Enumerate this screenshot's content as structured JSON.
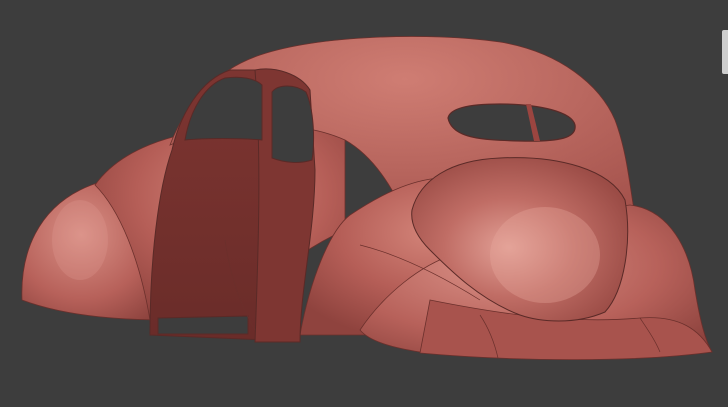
{
  "viewport": {
    "background": "#3d3d3d",
    "subject": "car-body-mesh"
  },
  "model": {
    "base_color": "#b9615a",
    "shadow_color": "#7a3430",
    "highlight_color": "#d88a80",
    "edge_color": "#5a2a27"
  }
}
